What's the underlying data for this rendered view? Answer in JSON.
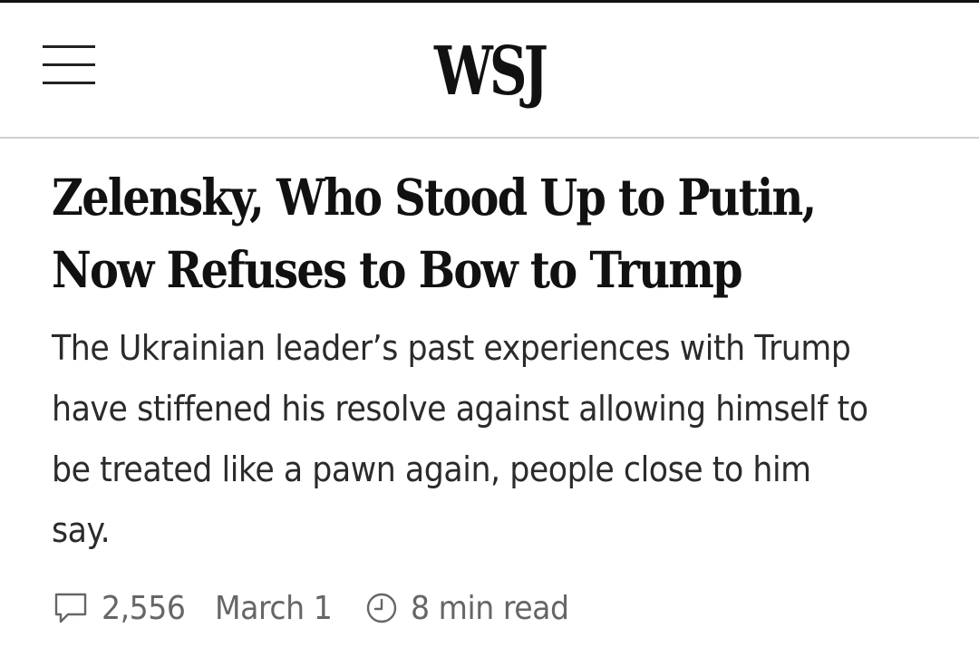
{
  "header": {
    "logo_text": "WSJ",
    "menu_icon": "hamburger-menu-icon"
  },
  "article": {
    "headline_line1": "Zelensky, Who Stood Up to Putin,",
    "headline_line2": "Now Refuses to Bow to Trump",
    "dek": "The Ukrainian leader’s past experiences with Trump have stiffened his resolve against allowing himself to be treated like a pawn again, people close to him say."
  },
  "meta": {
    "comment_icon": "comment-icon",
    "comment_count": "2,556",
    "date": "March 1",
    "clock_icon": "clock-icon",
    "read_time": "8 min read"
  }
}
